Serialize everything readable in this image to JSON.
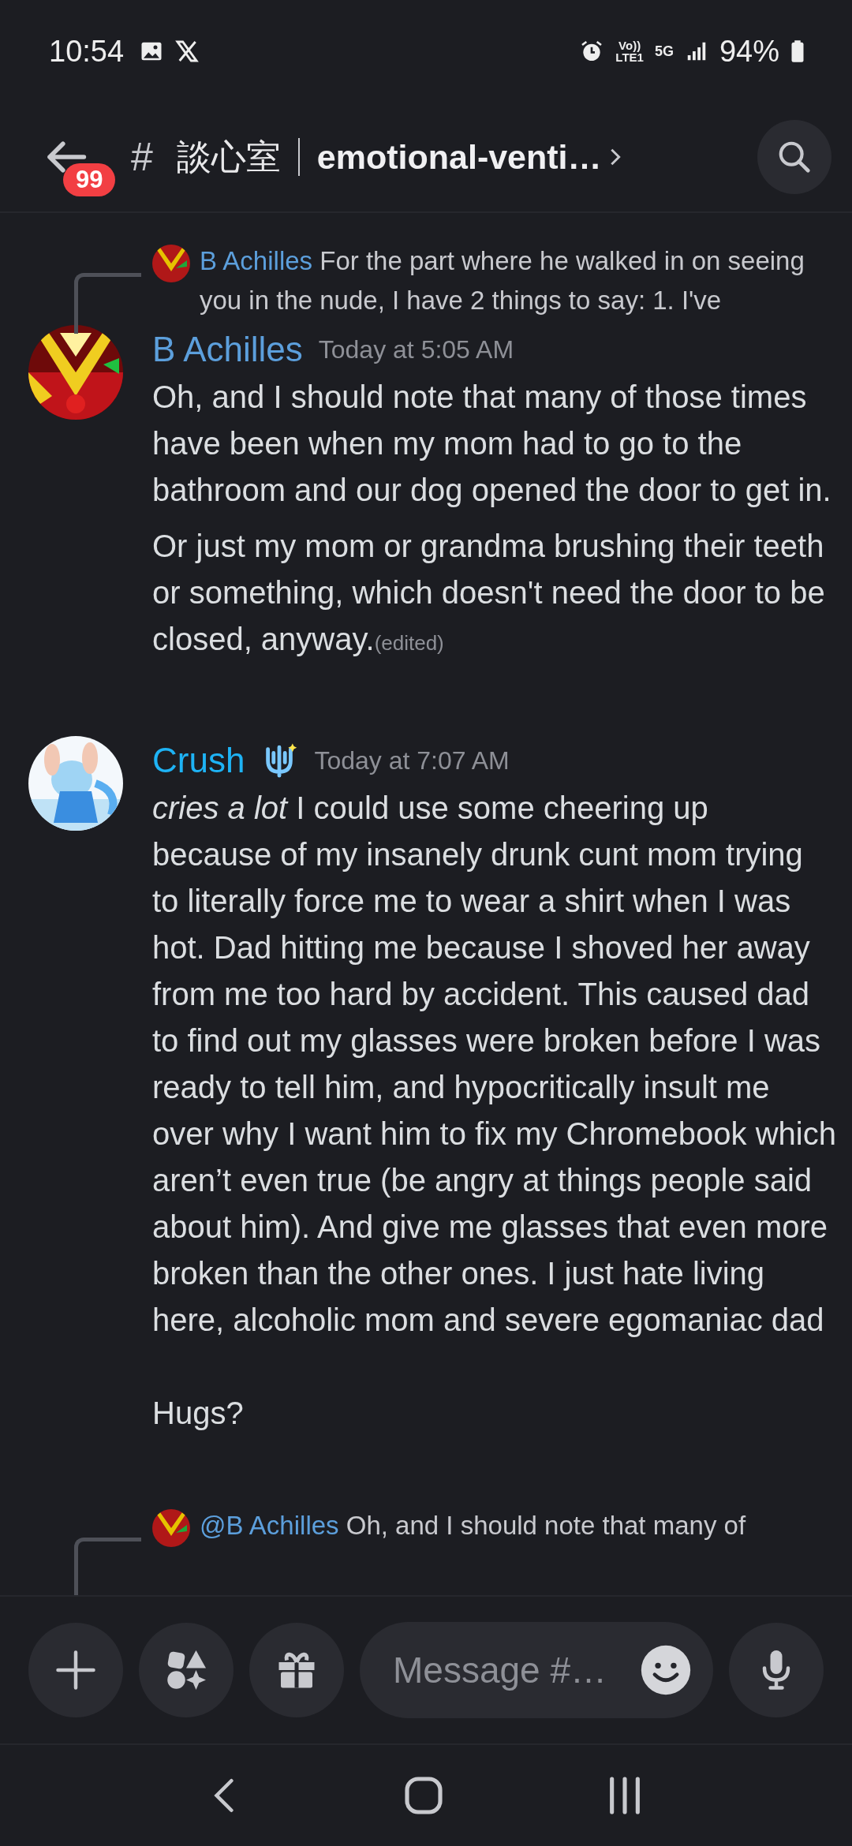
{
  "status_bar": {
    "time": "10:54",
    "volte_label": "Vo))",
    "lte_label": "LTE1",
    "network": "5G",
    "battery": "94%"
  },
  "header": {
    "unread_badge": "99",
    "hash": "#",
    "channel_name_cjk": "談心室",
    "channel_name": "emotional-venti…"
  },
  "messages": [
    {
      "reply": {
        "author": "B Achilles",
        "text": "For the part where he walked in on seeing you in the nude, I have 2 things to say: 1.  I've"
      },
      "author": "B Achilles",
      "color": "#5c9fdc",
      "badge": false,
      "timestamp": "Today at 5:05 AM",
      "paragraphs": [
        "Oh, and I should note that many of those times have been when my mom had to go to the bathroom and our dog opened the door to get in.",
        "Or just my mom or grandma brushing their teeth or something, which doesn't need the door to be closed, anyway."
      ],
      "edited": "(edited)"
    },
    {
      "author": "Crush",
      "color": "#1eb3f5",
      "badge": true,
      "timestamp": "Today at 7:07 AM",
      "paragraphs": [
        "*cries a lot* I could use some cheering up because of my insanely drunk cunt mom trying to literally force me to wear a shirt when I was hot. Dad hitting me because I shoved her away from me too hard by accident. This caused dad to find out my glasses were broken before I was ready to tell him, and hypocritically insult me over why I want him to fix my Chromebook which aren’t even true (be angry at things people said about him). And give me glasses that even more broken than the other ones. I just hate living here, alcoholic mom and severe egomaniac dad\n\nHugs?"
      ]
    },
    {
      "reply": {
        "author": "@B Achilles",
        "text": "Oh, and I should note that many of"
      }
    }
  ],
  "composer": {
    "placeholder": "Message #…"
  }
}
